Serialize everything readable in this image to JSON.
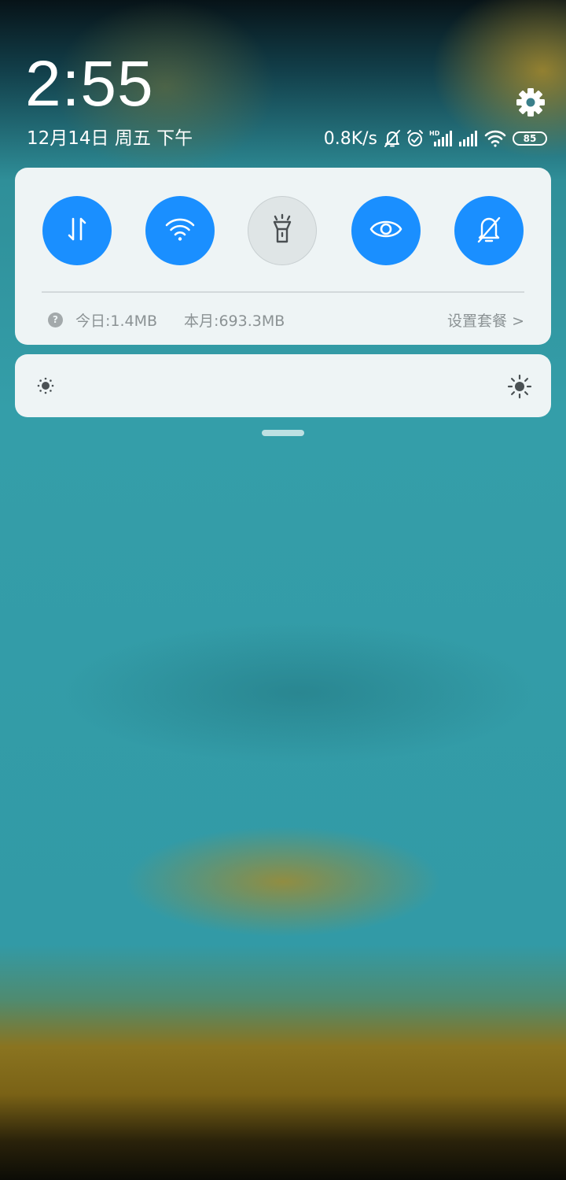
{
  "header": {
    "time": "2:55",
    "date": "12月14日 周五 下午"
  },
  "status_bar": {
    "net_speed": "0.8K/s",
    "icons": [
      "bell-muted-icon",
      "alarm-icon",
      "signal-hd-icon",
      "signal-icon",
      "wifi-icon"
    ],
    "battery_level": "85"
  },
  "quick_toggles": [
    {
      "name": "mobile-data",
      "icon": "data-arrows-icon",
      "state": "on"
    },
    {
      "name": "wifi",
      "icon": "wifi-icon",
      "state": "on"
    },
    {
      "name": "flashlight",
      "icon": "flashlight-icon",
      "state": "off"
    },
    {
      "name": "reading-mode",
      "icon": "eye-icon",
      "state": "on"
    },
    {
      "name": "silent",
      "icon": "bell-muted-icon",
      "state": "on"
    }
  ],
  "data_usage": {
    "today": "今日:1.4MB",
    "month": "本月:693.3MB",
    "plan_link": "设置套餐 >"
  },
  "colors": {
    "toggle_on": "#1a8fff",
    "toggle_off": "#dfe5e6",
    "card_bg": "#eef4f5"
  }
}
